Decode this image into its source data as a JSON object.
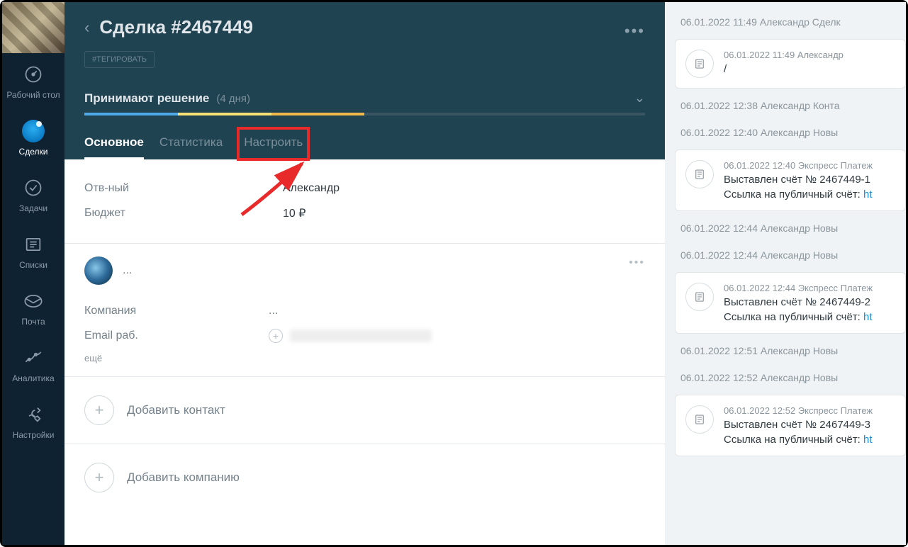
{
  "sidebar": {
    "items": [
      {
        "label": "Рабочий стол",
        "name": "nav-desktop"
      },
      {
        "label": "Сделки",
        "name": "nav-deals"
      },
      {
        "label": "Задачи",
        "name": "nav-tasks"
      },
      {
        "label": "Списки",
        "name": "nav-lists"
      },
      {
        "label": "Почта",
        "name": "nav-mail"
      },
      {
        "label": "Аналитика",
        "name": "nav-analytics"
      },
      {
        "label": "Настройки",
        "name": "nav-settings"
      }
    ]
  },
  "header": {
    "title": "Сделка #2467449",
    "tag_button": "#ТЕГИРОВАТЬ",
    "status_name": "Принимают решение",
    "status_days": "(4 дня)"
  },
  "tabs": {
    "main": "Основное",
    "stats": "Статистика",
    "settings": "Настроить"
  },
  "fields": {
    "responsible_label": "Отв-ный",
    "responsible_value": "Александр",
    "budget_label": "Бюджет",
    "budget_value": "10 ₽"
  },
  "contact": {
    "name": "...",
    "company_label": "Компания",
    "company_value": "...",
    "email_label": "Email раб.",
    "more": "ещё"
  },
  "add": {
    "contact": "Добавить контакт",
    "company": "Добавить компанию"
  },
  "feed": {
    "line1": "06.01.2022 11:49 Александр Сделк",
    "card1_meta": "06.01.2022 11:49 Александр",
    "card1_text": "/",
    "line2": "06.01.2022 12:38 Александр Конта",
    "line3": "06.01.2022 12:40 Александр Новы",
    "card2_meta": "06.01.2022 12:40 Экспресс Платеж",
    "card2_text1": "Выставлен счёт № 2467449-1",
    "card2_text2a": "Ссылка на публичный счёт: ",
    "card2_text2b": "ht",
    "line4": "06.01.2022 12:44 Александр Новы",
    "line5": "06.01.2022 12:44 Александр Новы",
    "card3_meta": "06.01.2022 12:44 Экспресс Платеж",
    "card3_text1": "Выставлен счёт № 2467449-2",
    "card3_text2a": "Ссылка на публичный счёт: ",
    "card3_text2b": "ht",
    "line6": "06.01.2022 12:51 Александр Новы",
    "line7": "06.01.2022 12:52 Александр Новы",
    "card4_meta": "06.01.2022 12:52 Экспресс Платеж",
    "card4_text1": "Выставлен счёт № 2467449-3",
    "card4_text2a": "Ссылка на публичный счёт: ",
    "card4_text2b": "ht"
  }
}
